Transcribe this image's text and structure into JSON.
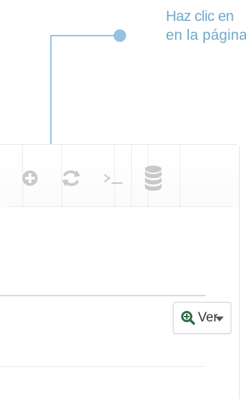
{
  "callout": {
    "line1": "Haz clic en",
    "line2": "en la página"
  },
  "toolbar": {
    "buttons": [
      {
        "name": "add",
        "icon": "plus-circle-icon"
      },
      {
        "name": "refresh",
        "icon": "refresh-icon"
      },
      {
        "name": "terminal",
        "icon": "terminal-icon"
      },
      {
        "name": "database",
        "icon": "database-icon"
      }
    ]
  },
  "view_button": {
    "label": "Ver",
    "icon": "zoom-icon"
  },
  "colors": {
    "callout": "#96c2e3",
    "callout_text": "#6fa8c9",
    "icon_gray": "#c9c9c9",
    "zoom_icon": "#2e6b43"
  }
}
